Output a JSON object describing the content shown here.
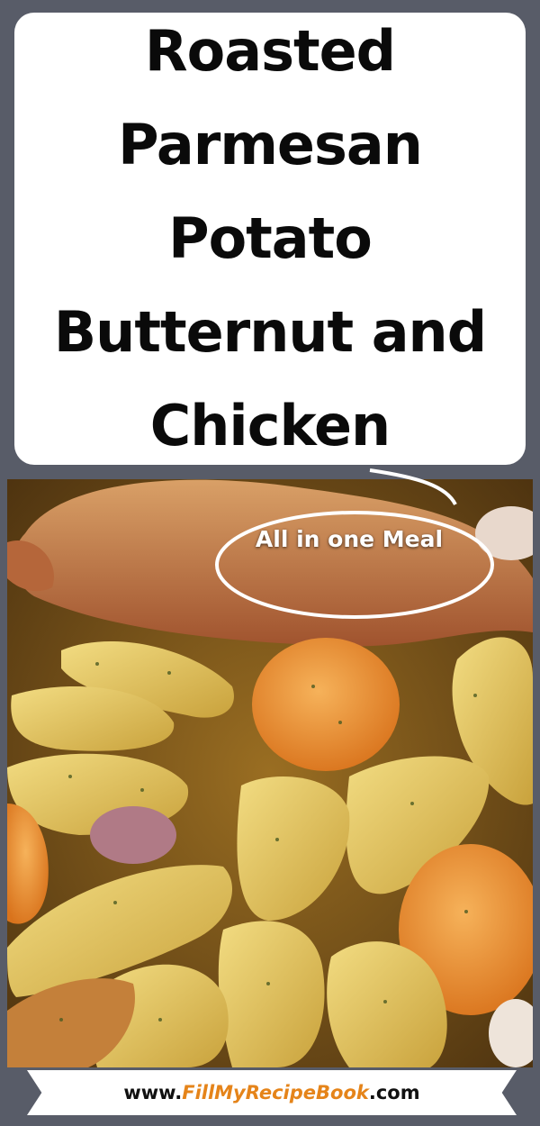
{
  "title": {
    "lines": [
      "Roasted",
      "Parmesan",
      "Potato",
      "Butternut and",
      "Chicken"
    ]
  },
  "callout": {
    "text": "All in one Meal"
  },
  "website": {
    "prefix": "www.",
    "name": "FillMyRecipeBook",
    "suffix": ".com"
  },
  "colors": {
    "background": "#585c68",
    "card": "#ffffff",
    "accent": "#e5841a"
  }
}
